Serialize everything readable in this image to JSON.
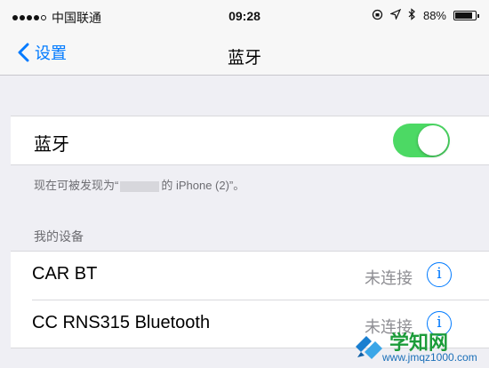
{
  "status_bar": {
    "carrier": "中国联通",
    "time": "09:28",
    "battery": "88%",
    "battery_level": 0.88
  },
  "nav": {
    "back_label": "设置",
    "title": "蓝牙"
  },
  "bluetooth": {
    "label": "蓝牙",
    "enabled": true,
    "toggle_color": "#4cd964"
  },
  "discoverable": {
    "prefix": "现在可被发现为“",
    "suffix": "的 iPhone (2)”。"
  },
  "devices_header": "我的设备",
  "devices": [
    {
      "name": "CAR BT",
      "status": "未连接"
    },
    {
      "name": "CC RNS315 Bluetooth",
      "status": "未连接"
    }
  ],
  "watermark": {
    "title": "学知网",
    "url": "www.jmqz1000.com"
  },
  "colors": {
    "accent": "#007aff",
    "background": "#efeff4"
  }
}
